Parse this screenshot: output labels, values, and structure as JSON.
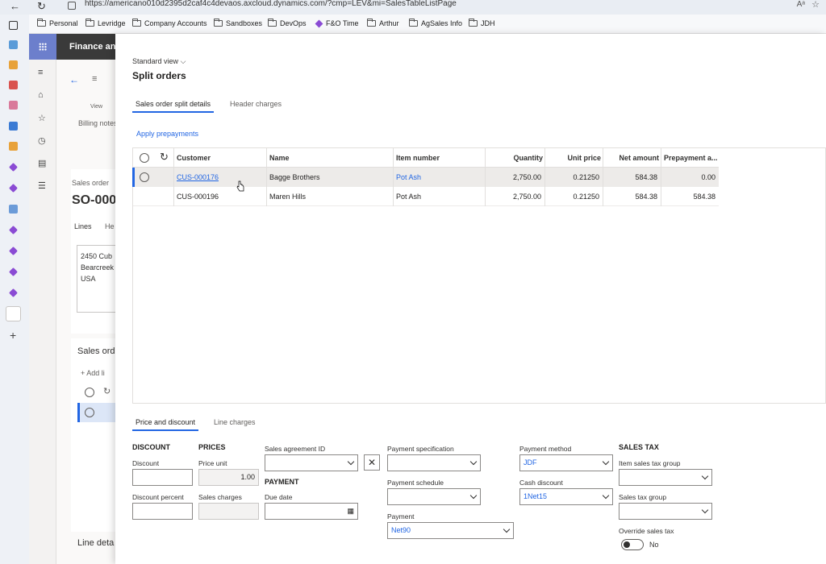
{
  "browser": {
    "url": "https://americano010d2395d2caf4c4devaos.axcloud.dynamics.com/?cmp=LEV&mi=SalesTableListPage",
    "bookmarks": [
      "Personal",
      "Levridge",
      "Company Accounts",
      "Sandboxes",
      "DevOps",
      "F&O Time",
      "Arthur",
      "AgSales Info",
      "JDH"
    ]
  },
  "app": {
    "name": "Finance an",
    "background": {
      "view_label": "View",
      "billing_notes": "Billing notes",
      "sales_order_label": "Sales order",
      "so_number": "SO-000",
      "lines_tab": "Lines",
      "he_tab": "He",
      "address": [
        "2450 Cub",
        "Bearcreek",
        "USA"
      ],
      "sales_ord": "Sales ord",
      "add_line": "+ Add li",
      "line_det": "Line deta"
    }
  },
  "dialog": {
    "view_selector": "Standard view",
    "title": "Split orders",
    "tabs": [
      "Sales order split details",
      "Header charges"
    ],
    "apply_prepayments": "Apply prepayments",
    "grid": {
      "columns": [
        "Customer",
        "Name",
        "Item number",
        "Quantity",
        "Unit price",
        "Net amount",
        "Prepayment a..."
      ],
      "rows": [
        {
          "customer": "CUS-000176",
          "name": "Bagge Brothers",
          "item": "Pot Ash",
          "quantity": "2,750.00",
          "unit_price": "0.21250",
          "net_amount": "584.38",
          "prepayment": "0.00",
          "selected": true
        },
        {
          "customer": "CUS-000196",
          "name": "Maren Hills",
          "item": "Pot Ash",
          "quantity": "2,750.00",
          "unit_price": "0.21250",
          "net_amount": "584.38",
          "prepayment": "584.38",
          "selected": false
        }
      ]
    },
    "bottom_tabs": [
      "Price and discount",
      "Line charges"
    ],
    "discount": {
      "heading": "DISCOUNT",
      "discount_label": "Discount",
      "discount_value": "",
      "percent_label": "Discount percent",
      "percent_value": ""
    },
    "prices": {
      "heading": "PRICES",
      "price_unit_label": "Price unit",
      "price_unit_value": "1.00",
      "sales_charges_label": "Sales charges",
      "sales_charges_value": ""
    },
    "agreement": {
      "label": "Sales agreement ID",
      "value": ""
    },
    "payment": {
      "heading": "PAYMENT",
      "due_date_label": "Due date",
      "due_date_value": ""
    },
    "payment_spec": {
      "label": "Payment specification",
      "value": ""
    },
    "payment_schedule": {
      "label": "Payment schedule",
      "value": ""
    },
    "payment_terms": {
      "label": "Payment",
      "value": "Net90"
    },
    "payment_method": {
      "label": "Payment method",
      "value": "JDF"
    },
    "cash_discount": {
      "label": "Cash discount",
      "value": "1Net15"
    },
    "sales_tax": {
      "heading": "SALES TAX",
      "item_group_label": "Item sales tax group",
      "item_group_value": "",
      "group_label": "Sales tax group",
      "group_value": "",
      "override_label": "Override sales tax",
      "override_value": "No"
    }
  }
}
